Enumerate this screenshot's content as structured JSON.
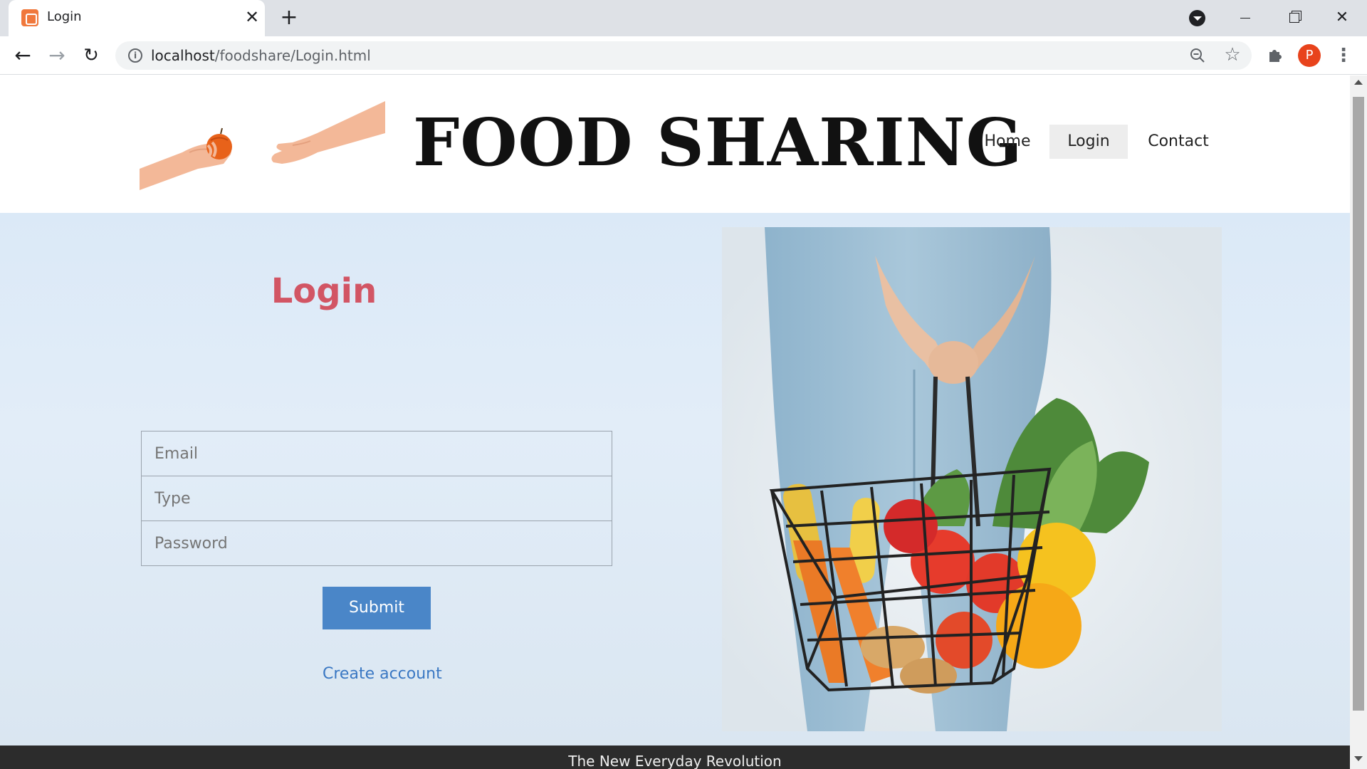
{
  "browser": {
    "tab_title": "Login",
    "url_host": "localhost",
    "url_path": "/foodshare/Login.html",
    "profile_initial": "P"
  },
  "header": {
    "site_title": "FOOD SHARING",
    "nav": [
      "Home",
      "Login",
      "Contact"
    ],
    "active_nav": "Login"
  },
  "login": {
    "heading": "Login",
    "email_placeholder": "Email",
    "type_placeholder": "Type",
    "password_placeholder": "Password",
    "submit_label": "Submit",
    "create_account_label": "Create account"
  },
  "footer": {
    "tagline": "The New Everyday Revolution"
  },
  "colors": {
    "heading": "#d25564",
    "button": "#4a86c8",
    "link": "#3a78c3",
    "footer_bg": "#2c2c2c",
    "profile": "#e8431c"
  },
  "icons": [
    "xampp-favicon",
    "close-icon",
    "plus-icon",
    "back-arrow-icon",
    "forward-arrow-icon",
    "reload-icon",
    "info-icon",
    "zoom-out-icon",
    "star-icon",
    "puzzle-icon",
    "kebab-menu-icon"
  ]
}
